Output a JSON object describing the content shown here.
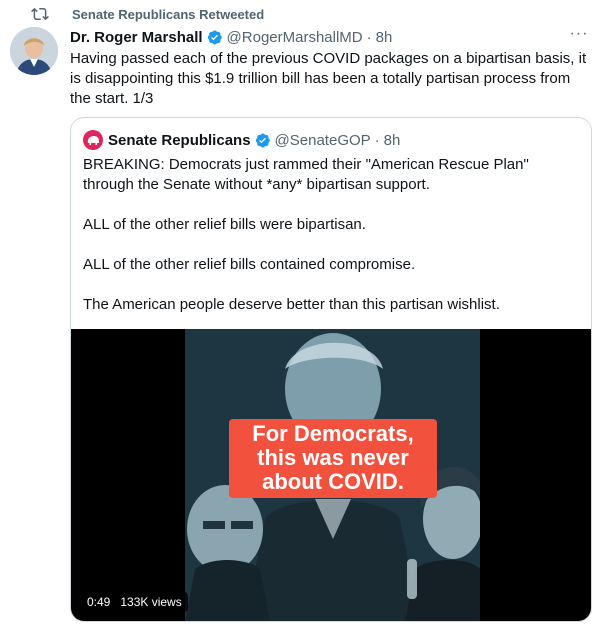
{
  "retweet": {
    "text": "Senate Republicans Retweeted"
  },
  "tweet": {
    "name": "Dr. Roger Marshall",
    "handle": "@RogerMarshallMD",
    "separator": "·",
    "time": "8h",
    "more": "···",
    "lines": [
      "Having passed each of the previous COVID packages on a bipartisan basis, it",
      "is disappointing this $1.9 trillion bill has been a totally partisan process from",
      "the start. 1/3"
    ]
  },
  "quote": {
    "name": "Senate Republicans",
    "handle": "@SenateGOP",
    "separator": "·",
    "time": "8h",
    "paragraphs": [
      [
        "BREAKING: Democrats just rammed their \"American Rescue Plan\"",
        "through the Senate without *any* bipartisan support."
      ],
      [
        "ALL of the other relief bills were bipartisan."
      ],
      [
        "ALL of the other relief bills contained compromise."
      ],
      [
        "The American people deserve better than this partisan wishlist."
      ]
    ],
    "video": {
      "caption": [
        "For Democrats,",
        "this was never",
        "about COVID."
      ],
      "duration": "0:49",
      "views": "133K views"
    }
  },
  "colors": {
    "accent": "#1d9bf0",
    "caption_bg": "#f2513e",
    "muted": "#536471",
    "border": "#cfd9de"
  },
  "icons": {
    "retweet": "retweet-icon",
    "verified": "verified-badge-icon",
    "more": "more-icon",
    "gop": "gop-elephant-icon"
  }
}
